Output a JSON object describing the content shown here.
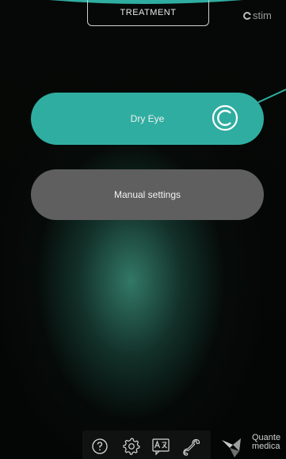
{
  "header": {
    "tab_label": "TREATMENT",
    "brand_text": "stim"
  },
  "main": {
    "buttons": [
      {
        "label": "Dry Eye",
        "icon": "c-logo-icon"
      },
      {
        "label": "Manual settings"
      }
    ]
  },
  "toolbar": {
    "icons": [
      "help-icon",
      "settings-icon",
      "translate-icon",
      "wrench-icon"
    ]
  },
  "footer": {
    "logo_line1": "Quante",
    "logo_line2": "medica"
  },
  "colors": {
    "accent": "#2fada0",
    "secondary": "#5f5f5f",
    "background": "#050807"
  }
}
